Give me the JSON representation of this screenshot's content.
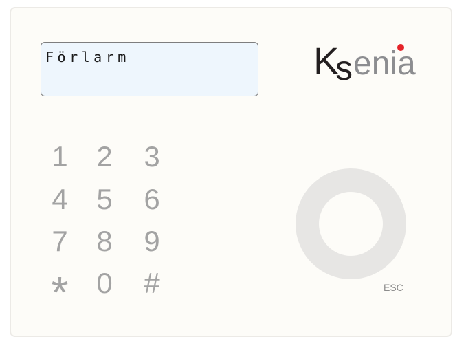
{
  "display": {
    "text": "Förlarm"
  },
  "logo": {
    "brand_k": "K",
    "brand_s": "s",
    "brand_rest": "enia",
    "dark_color": "#231f20",
    "grey_color": "#8c8d90",
    "dot_color": "#e52329"
  },
  "keypad": {
    "keys": [
      "1",
      "2",
      "3",
      "4",
      "5",
      "6",
      "7",
      "8",
      "9",
      "*",
      "0",
      "#"
    ]
  },
  "esc": {
    "label": "ESC"
  },
  "colors": {
    "panel_bg": "#fdfcf8",
    "display_bg": "#eef6fd",
    "key_color": "#a3a3a3",
    "ring_color": "#e7e6e4"
  }
}
